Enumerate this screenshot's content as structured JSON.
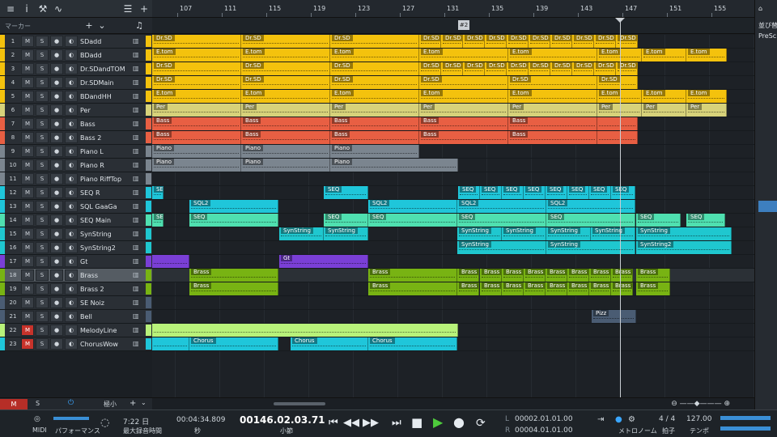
{
  "toolbar": {
    "icons": [
      "menu-icon",
      "info-icon",
      "wrench-icon",
      "automation-curve-icon",
      "list-icon",
      "plus-icon"
    ]
  },
  "marker_header": {
    "label": "マーカー",
    "add": "+",
    "more": "⌄",
    "note_icon": "♫"
  },
  "ruler": {
    "bars": [
      "107",
      "111",
      "115",
      "119",
      "123",
      "127",
      "131",
      "135",
      "139",
      "143",
      "147",
      "151",
      "155"
    ]
  },
  "marker": {
    "label": "#2"
  },
  "colors": {
    "yellow": "#f4c20d",
    "yellow_light": "#f2e27a",
    "orange": "#ea7a2a",
    "coral": "#e85f43",
    "gray": "#7b858f",
    "cyan": "#1fc6da",
    "mint": "#4fe0b0",
    "teal": "#1fc7cf",
    "purple": "#7a3fd6",
    "green": "#78b313",
    "light_green": "#b8f27a",
    "slate": "#4a5c73"
  },
  "tracks": [
    {
      "num": "1",
      "name": "SDadd",
      "color": "#f4c20d",
      "m": false
    },
    {
      "num": "2",
      "name": "BDadd",
      "color": "#f4c20d",
      "m": false
    },
    {
      "num": "3",
      "name": "Dr.SDandTOM",
      "color": "#f4c20d",
      "m": false
    },
    {
      "num": "4",
      "name": "Dr.SDMain",
      "color": "#f4c20d",
      "m": false
    },
    {
      "num": "5",
      "name": "BDandHH",
      "color": "#f4c20d",
      "m": false
    },
    {
      "num": "6",
      "name": "Per",
      "color": "#d7d27a",
      "m": false
    },
    {
      "num": "7",
      "name": "Bass",
      "color": "#e85f43",
      "m": false
    },
    {
      "num": "8",
      "name": "Bass 2",
      "color": "#e85f43",
      "m": false
    },
    {
      "num": "9",
      "name": "Piano L",
      "color": "#7b858f",
      "m": false
    },
    {
      "num": "10",
      "name": "Piano R",
      "color": "#7b858f",
      "m": false
    },
    {
      "num": "11",
      "name": "Piano RiffTop",
      "color": "#7b858f",
      "m": false
    },
    {
      "num": "12",
      "name": "SEQ R",
      "color": "#1fc6da",
      "m": false
    },
    {
      "num": "13",
      "name": "SQL GaaGa",
      "color": "#1fc6da",
      "m": false
    },
    {
      "num": "14",
      "name": "SEQ Main",
      "color": "#4fe0b0",
      "m": false
    },
    {
      "num": "15",
      "name": "SynString",
      "color": "#1fc7cf",
      "m": false
    },
    {
      "num": "16",
      "name": "SynString2",
      "color": "#1fc7cf",
      "m": false
    },
    {
      "num": "17",
      "name": "Gt",
      "color": "#7a3fd6",
      "m": false
    },
    {
      "num": "18",
      "name": "Brass",
      "color": "#78b313",
      "m": false
    },
    {
      "num": "19",
      "name": "Brass 2",
      "color": "#78b313",
      "m": false
    },
    {
      "num": "20",
      "name": "SE Noiz",
      "color": "#4a5c73",
      "m": false
    },
    {
      "num": "21",
      "name": "Bell",
      "color": "#4a5c73",
      "m": false
    },
    {
      "num": "22",
      "name": "MelodyLine",
      "color": "#b8f27a",
      "m": true
    },
    {
      "num": "23",
      "name": "ChorusWow",
      "color": "#1fc6da",
      "m": true
    }
  ],
  "track_buttons": {
    "mute": "M",
    "solo": "S",
    "rec": "●",
    "monitor": "◐"
  },
  "clips": [
    {
      "t": 0,
      "c": "#f4c20d",
      "l": [
        [
          "Dr.SD",
          0,
          110
        ],
        [
          "Dr.SD",
          110,
          110
        ],
        [
          "Dr.SD",
          220,
          110
        ],
        [
          "Dr.SD",
          330,
          27
        ],
        [
          "Dr.SD",
          357,
          27
        ],
        [
          "Dr.SD",
          384,
          27
        ],
        [
          "Dr.SD",
          411,
          27
        ],
        [
          "Dr.SD",
          438,
          27
        ],
        [
          "Dr.SD",
          465,
          27
        ],
        [
          "Dr.SD",
          492,
          27
        ],
        [
          "Dr.SD",
          519,
          27
        ],
        [
          "Dr.SD",
          546,
          27
        ],
        [
          "Dr.SD",
          573,
          27
        ]
      ]
    },
    {
      "t": 1,
      "c": "#f4c20d",
      "l": [
        [
          "E.tom",
          0,
          110
        ],
        [
          "E.tom",
          110,
          110
        ],
        [
          "E.tom",
          220,
          110
        ],
        [
          "E.tom",
          330,
          110
        ],
        [
          "E.tom",
          440,
          110
        ],
        [
          "E.tom",
          550,
          55
        ],
        [
          "E.tom",
          605,
          55
        ],
        [
          "E.tom",
          660,
          50
        ]
      ]
    },
    {
      "t": 2,
      "c": "#f4c20d",
      "l": [
        [
          "Dr.SD",
          0,
          110
        ],
        [
          "Dr.SD",
          110,
          110
        ],
        [
          "Dr.SD",
          220,
          110
        ],
        [
          "Dr.SD",
          330,
          27
        ],
        [
          "Dr.SD",
          357,
          27
        ],
        [
          "Dr.SD",
          384,
          27
        ],
        [
          "Dr.SD",
          411,
          27
        ],
        [
          "Dr.SD",
          438,
          27
        ],
        [
          "Dr.SD",
          465,
          27
        ],
        [
          "Dr.SD",
          492,
          27
        ],
        [
          "Dr.SD",
          519,
          27
        ],
        [
          "Dr.SD",
          546,
          27
        ],
        [
          "Dr.SD",
          573,
          27
        ]
      ]
    },
    {
      "t": 3,
      "c": "#f4c20d",
      "l": [
        [
          "Dr.SD",
          0,
          110
        ],
        [
          "Dr.SD",
          110,
          110
        ],
        [
          "Dr.SD",
          220,
          110
        ],
        [
          "Dr.SD",
          330,
          110
        ],
        [
          "Dr.SD",
          440,
          110
        ],
        [
          "Dr.SD",
          550,
          50
        ]
      ]
    },
    {
      "t": 4,
      "c": "#f4c20d",
      "l": [
        [
          "E.tom",
          0,
          110
        ],
        [
          "E.tom",
          110,
          110
        ],
        [
          "E.tom",
          220,
          110
        ],
        [
          "E.tom",
          330,
          110
        ],
        [
          "E.tom",
          440,
          110
        ],
        [
          "E.tom",
          550,
          55
        ],
        [
          "E.tom",
          605,
          55
        ],
        [
          "E.tom",
          660,
          50
        ]
      ]
    },
    {
      "t": 5,
      "c": "#d7d27a",
      "l": [
        [
          "Per",
          0,
          110
        ],
        [
          "Per",
          110,
          110
        ],
        [
          "Per",
          220,
          110
        ],
        [
          "Per",
          330,
          110
        ],
        [
          "Per",
          440,
          110
        ],
        [
          "Per",
          550,
          55
        ],
        [
          "Per",
          605,
          55
        ],
        [
          "Per",
          660,
          50
        ]
      ]
    },
    {
      "t": 6,
      "c": "#e85f43",
      "l": [
        [
          "Bass",
          0,
          110
        ],
        [
          "Bass",
          110,
          110
        ],
        [
          "Bass",
          220,
          110
        ],
        [
          "Bass",
          330,
          110
        ],
        [
          "Bass",
          440,
          110
        ],
        [
          "",
          550,
          50
        ]
      ]
    },
    {
      "t": 7,
      "c": "#e85f43",
      "l": [
        [
          "Bass",
          0,
          110
        ],
        [
          "Bass",
          110,
          110
        ],
        [
          "Bass",
          220,
          110
        ],
        [
          "Bass",
          330,
          110
        ],
        [
          "Bass",
          440,
          110
        ],
        [
          "",
          550,
          50
        ]
      ]
    },
    {
      "t": 8,
      "c": "#7b858f",
      "l": [
        [
          "Piano",
          0,
          110
        ],
        [
          "Piano",
          110,
          110
        ],
        [
          "Piano",
          220,
          110
        ]
      ]
    },
    {
      "t": 9,
      "c": "#7b858f",
      "l": [
        [
          "Piano",
          0,
          110
        ],
        [
          "Piano",
          110,
          110
        ],
        [
          "Piano",
          220,
          158
        ]
      ]
    },
    {
      "t": 11,
      "c": "#1fc6da",
      "l": [
        [
          "SEQ",
          0,
          14
        ],
        [
          "SEQ",
          212,
          55
        ],
        [
          "SEQ",
          378,
          27
        ],
        [
          "SEQ",
          405,
          27
        ],
        [
          "SEQ",
          432,
          27
        ],
        [
          "SEQ",
          459,
          27
        ],
        [
          "SEQ",
          486,
          27
        ],
        [
          "SEQ",
          513,
          27
        ],
        [
          "SEQ",
          540,
          27
        ],
        [
          "SEQ",
          567,
          30
        ]
      ]
    },
    {
      "t": 12,
      "c": "#1fc6da",
      "l": [
        [
          "SQL2",
          46,
          110
        ],
        [
          "SQL2",
          267,
          110
        ],
        [
          "SQL2",
          377,
          110
        ],
        [
          "SQL2",
          487,
          110
        ]
      ]
    },
    {
      "t": 13,
      "c": "#4fe0b0",
      "l": [
        [
          "SEQ",
          0,
          14
        ],
        [
          "SEQ",
          46,
          110
        ],
        [
          "SEQ",
          212,
          55
        ],
        [
          "SEQ",
          267,
          110
        ],
        [
          "SEQ",
          377,
          110
        ],
        [
          "SEQ",
          487,
          110
        ],
        [
          "SEQ",
          598,
          55
        ],
        [
          "SEQ",
          660,
          48
        ]
      ]
    },
    {
      "t": 14,
      "c": "#1fc7cf",
      "l": [
        [
          "SynString",
          157,
          55
        ],
        [
          "SynString",
          212,
          55
        ],
        [
          "SynString",
          377,
          55
        ],
        [
          "SynString",
          432,
          55
        ],
        [
          "SynString",
          487,
          55
        ],
        [
          "SynString",
          542,
          55
        ],
        [
          "SynString",
          598,
          118
        ]
      ]
    },
    {
      "t": 15,
      "c": "#1fc7cf",
      "l": [
        [
          "SynString",
          377,
          110
        ],
        [
          "SynString",
          487,
          110
        ],
        [
          "SynString2",
          598,
          118
        ]
      ]
    },
    {
      "t": 16,
      "c": "#7a3fd6",
      "l": [
        [
          "",
          0,
          46
        ],
        [
          "Gt",
          157,
          110
        ]
      ]
    },
    {
      "t": 17,
      "c": "#78b313",
      "l": [
        [
          "Brass",
          46,
          110
        ],
        [
          "Brass",
          267,
          110
        ],
        [
          "Brass",
          377,
          27
        ],
        [
          "Brass",
          405,
          27
        ],
        [
          "Brass",
          432,
          27
        ],
        [
          "Brass",
          459,
          27
        ],
        [
          "Brass",
          486,
          27
        ],
        [
          "Brass",
          513,
          27
        ],
        [
          "Brass",
          540,
          27
        ],
        [
          "Brass",
          567,
          27
        ],
        [
          "Brass",
          598,
          42
        ]
      ]
    },
    {
      "t": 18,
      "c": "#78b313",
      "l": [
        [
          "Brass",
          46,
          110
        ],
        [
          "Brass",
          267,
          110
        ],
        [
          "Brass",
          377,
          27
        ],
        [
          "Brass",
          405,
          27
        ],
        [
          "Brass",
          432,
          27
        ],
        [
          "Brass",
          459,
          27
        ],
        [
          "Brass",
          486,
          27
        ],
        [
          "Brass",
          513,
          27
        ],
        [
          "Brass",
          540,
          27
        ],
        [
          "Brass",
          567,
          27
        ],
        [
          "Brass",
          598,
          42
        ]
      ]
    },
    {
      "t": 20,
      "c": "#4a5c73",
      "l": [
        [
          "Pizz",
          543,
          55
        ]
      ]
    },
    {
      "t": 21,
      "c": "#b8f27a",
      "l": [
        [
          "",
          0,
          378
        ]
      ]
    },
    {
      "t": 22,
      "c": "#1fc6da",
      "l": [
        [
          "",
          0,
          46
        ],
        [
          "Chorus",
          46,
          110
        ],
        [
          "Chorus",
          171,
          96
        ],
        [
          "Chorus",
          267,
          110
        ]
      ]
    }
  ],
  "left_footer": {
    "m": "M",
    "s": "S",
    "power": "⏻",
    "size": "極小",
    "plus": "+",
    "chev": "⌄"
  },
  "right_pane": {
    "title": "並び替",
    "item": "PreSc"
  },
  "transport": {
    "midi": "MIDI",
    "performance": "パフォーマンス",
    "time": "7:22 日",
    "rec_max": "最大録音時間",
    "sec_time": "00:04:34.809",
    "sec_label": "秒",
    "position": "00146.02.03.71",
    "pos_label": "小節",
    "L_label": "L",
    "L_value": "00002.01.01.00",
    "R_label": "R",
    "R_value": "00004.01.01.00",
    "metronome": "メトロノーム",
    "signature": "4 / 4",
    "sig_label": "拍子",
    "tempo": "127.00",
    "tempo_label": "テンポ"
  }
}
